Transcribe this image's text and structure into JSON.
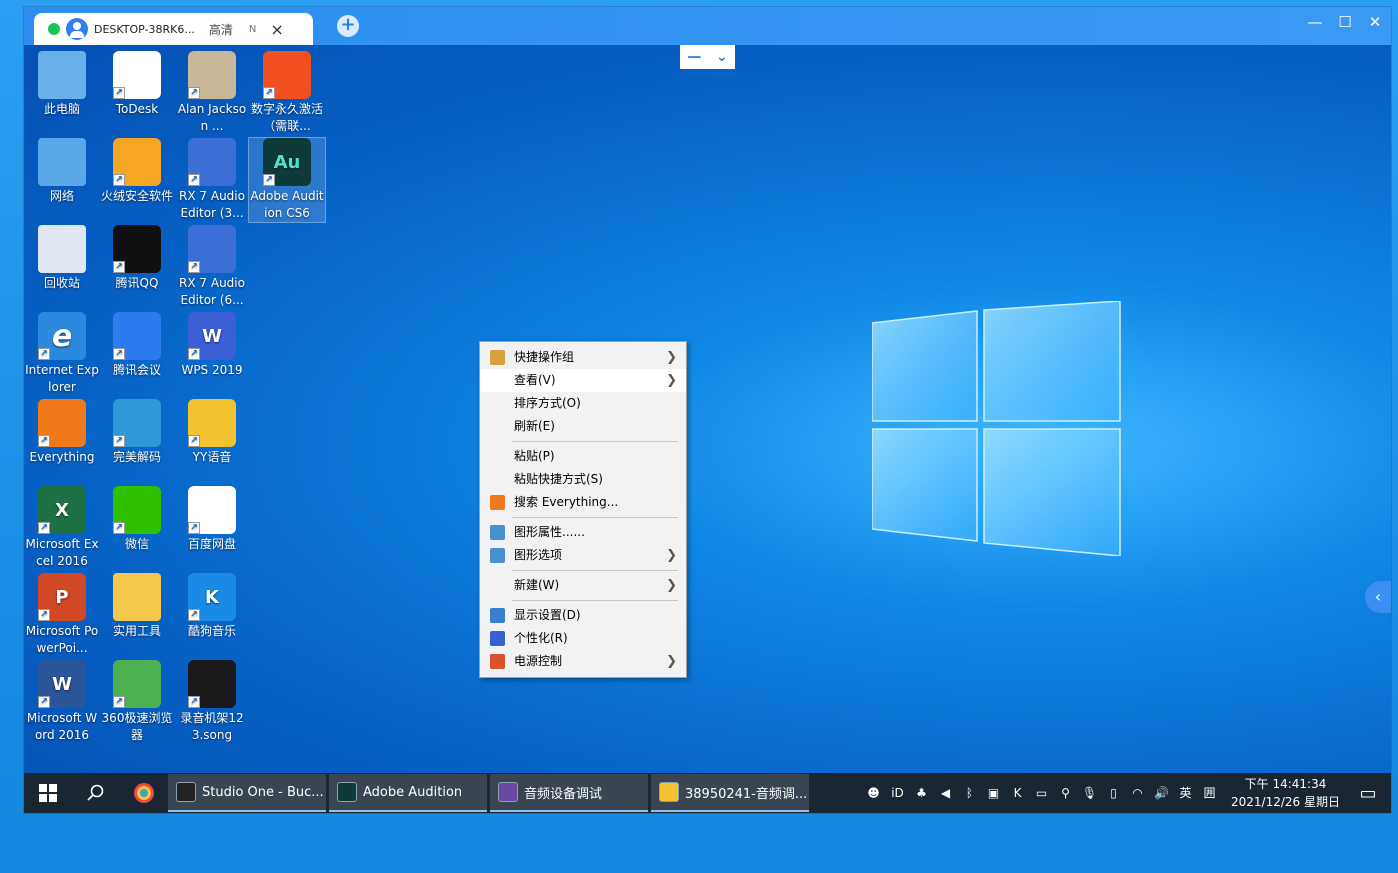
{
  "session_tab": {
    "host": "DESKTOP-38RK6...",
    "quality": "高清",
    "badge": "N",
    "close": "×"
  },
  "add_tab": "+",
  "window_controls": {
    "minimize": "—",
    "maximize": "☐",
    "close": "✕"
  },
  "float_toolbar": {
    "minimize": "—",
    "expand": "⌄"
  },
  "side_handle": "‹",
  "desktop_icons": [
    {
      "label": "此电脑",
      "icon": "computer-icon",
      "color": "#6ab0e8"
    },
    {
      "label": "ToDesk",
      "icon": "todesk-icon",
      "color": "#ffffff"
    },
    {
      "label": "Alan Jackson ...",
      "icon": "album-art-icon",
      "color": "#c9b79a"
    },
    {
      "label": "数字永久激活（需联...",
      "icon": "windows-activation-icon",
      "color": "#f25022"
    },
    {
      "label": "网络",
      "icon": "network-icon",
      "color": "#5aa8e8"
    },
    {
      "label": "火绒安全软件",
      "icon": "huorong-icon",
      "color": "#f5a623"
    },
    {
      "label": "RX 7 Audio Editor (3...",
      "icon": "rx-audio-icon",
      "color": "#3b6fd6"
    },
    {
      "label": "Adobe Audition CS6",
      "icon": "adobe-audition-icon",
      "color": "#0f3a3a",
      "text": "Au"
    },
    {
      "label": "回收站",
      "icon": "recycle-bin-icon",
      "color": "#dfe8f2"
    },
    {
      "label": "腾讯QQ",
      "icon": "qq-icon",
      "color": "#111111"
    },
    {
      "label": "RX 7 Audio Editor (6...",
      "icon": "rx-audio-icon",
      "color": "#3b6fd6"
    },
    {
      "label": "Internet Explorer",
      "icon": "internet-explorer-icon",
      "color": "#2b8ae0",
      "text": "e"
    },
    {
      "label": "腾讯会议",
      "icon": "tencent-meeting-icon",
      "color": "#2d7bf0"
    },
    {
      "label": "WPS 2019",
      "icon": "wps-icon",
      "color": "#3b5fd6",
      "text": "W"
    },
    {
      "label": "Everything",
      "icon": "everything-icon",
      "color": "#f07a1a"
    },
    {
      "label": "完美解码",
      "icon": "potplayer-icon",
      "color": "#2b9ad6"
    },
    {
      "label": "YY语音",
      "icon": "yy-voice-icon",
      "color": "#f2c230"
    },
    {
      "label": "Microsoft Excel 2016",
      "icon": "excel-icon",
      "color": "#1e7145",
      "text": "X"
    },
    {
      "label": "微信",
      "icon": "wechat-icon",
      "color": "#2dc100"
    },
    {
      "label": "百度网盘",
      "icon": "baidu-netdisk-icon",
      "color": "#ffffff"
    },
    {
      "label": "Microsoft PowerPoi...",
      "icon": "powerpoint-icon",
      "color": "#d24726",
      "text": "P"
    },
    {
      "label": "实用工具",
      "icon": "folder-icon",
      "color": "#f3c84b"
    },
    {
      "label": "酷狗音乐",
      "icon": "kugou-icon",
      "color": "#1a8ae8",
      "text": "K"
    },
    {
      "label": "Microsoft Word 2016",
      "icon": "word-icon",
      "color": "#2b579a",
      "text": "W"
    },
    {
      "label": "360极速浏览器",
      "icon": "360-browser-icon",
      "color": "#4caf50"
    },
    {
      "label": "录音机架123.song",
      "icon": "studio-one-song-icon",
      "color": "#1a1a1a"
    }
  ],
  "context_menu": [
    {
      "label": "快捷操作组",
      "icon": "quick-actions-icon",
      "arrow": true,
      "color": "#d9a13b"
    },
    {
      "label": "查看(V)",
      "icon": "",
      "arrow": true,
      "hover": true
    },
    {
      "label": "排序方式(O)",
      "icon": "",
      "arrow": false
    },
    {
      "label": "刷新(E)",
      "icon": "",
      "arrow": false
    },
    {
      "sep": true
    },
    {
      "label": "粘贴(P)",
      "icon": "",
      "arrow": false
    },
    {
      "label": "粘贴快捷方式(S)",
      "icon": "",
      "arrow": false
    },
    {
      "label": "搜索 Everything...",
      "icon": "everything-search-icon",
      "arrow": false,
      "color": "#f07a1a"
    },
    {
      "sep": true
    },
    {
      "label": "图形属性......",
      "icon": "graphics-properties-icon",
      "arrow": false,
      "color": "#4a8fd0"
    },
    {
      "label": "图形选项",
      "icon": "graphics-options-icon",
      "arrow": true,
      "color": "#4a8fd0"
    },
    {
      "sep": true
    },
    {
      "label": "新建(W)",
      "icon": "",
      "arrow": true
    },
    {
      "sep": true
    },
    {
      "label": "显示设置(D)",
      "icon": "display-settings-icon",
      "arrow": false,
      "color": "#3a7fd0"
    },
    {
      "label": "个性化(R)",
      "icon": "personalize-icon",
      "arrow": false,
      "color": "#3a5fd0"
    },
    {
      "label": "电源控制",
      "icon": "power-control-icon",
      "arrow": true,
      "color": "#d9542b"
    }
  ],
  "taskbar": {
    "items": [
      {
        "label": "Studio One - Buc...",
        "icon": "studio-one-icon",
        "color": "#222222"
      },
      {
        "label": "Adobe Audition",
        "icon": "adobe-audition-icon",
        "color": "#0f3a3a"
      },
      {
        "label": "音频设备调试",
        "icon": "audio-device-icon",
        "color": "#6a4aa0"
      },
      {
        "label": "38950241-音频调...",
        "icon": "yy-voice-icon",
        "color": "#f2c230"
      }
    ],
    "tray": [
      {
        "icon": "yy-tray-icon",
        "text": "☻"
      },
      {
        "icon": "id-tray-icon",
        "text": "iD"
      },
      {
        "icon": "qq-tray-icon",
        "text": "♣"
      },
      {
        "icon": "speaker-muted-icon",
        "text": "◀"
      },
      {
        "icon": "bluetooth-icon",
        "text": "ᛒ"
      },
      {
        "icon": "app-tray-icon",
        "text": "▣"
      },
      {
        "icon": "kugou-tray-icon",
        "text": "K"
      },
      {
        "icon": "monitor-tray-icon",
        "text": "▭"
      },
      {
        "icon": "everything-tray-icon",
        "text": "⚲"
      },
      {
        "icon": "microphone-icon",
        "text": "🎙"
      },
      {
        "icon": "battery-icon",
        "text": "▯"
      },
      {
        "icon": "wifi-icon",
        "text": "◠"
      },
      {
        "icon": "volume-icon",
        "text": "🔊"
      },
      {
        "icon": "ime-icon",
        "text": "英"
      },
      {
        "icon": "keyboard-layout-icon",
        "text": "囲"
      }
    ],
    "time": "下午 14:41:34",
    "date": "2021/12/26 星期日"
  }
}
